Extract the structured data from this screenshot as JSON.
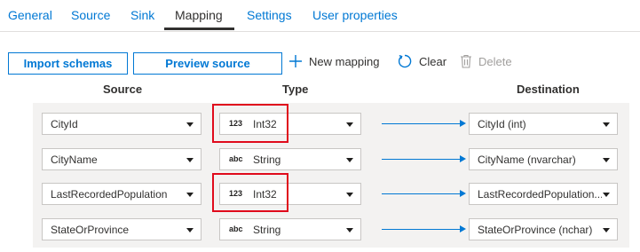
{
  "tabs": [
    {
      "label": "General"
    },
    {
      "label": "Source"
    },
    {
      "label": "Sink"
    },
    {
      "label": "Mapping"
    },
    {
      "label": "Settings"
    },
    {
      "label": "User properties"
    }
  ],
  "active_tab": "Mapping",
  "toolbar": {
    "import_schemas": "Import schemas",
    "preview_source": "Preview source",
    "new_mapping": "New mapping",
    "clear": "Clear",
    "delete": "Delete"
  },
  "columns": {
    "source": "Source",
    "type": "Type",
    "destination": "Destination"
  },
  "rows": [
    {
      "source": "CityId",
      "type_badge": "123",
      "type": "Int32",
      "destination": "CityId (int)",
      "highlighted": true
    },
    {
      "source": "CityName",
      "type_badge": "abc",
      "type": "String",
      "destination": "CityName (nvarchar)",
      "highlighted": false
    },
    {
      "source": "LastRecordedPopulation",
      "type_badge": "123",
      "type": "Int32",
      "destination": "LastRecordedPopulation...",
      "highlighted": true
    },
    {
      "source": "StateOrProvince",
      "type_badge": "abc",
      "type": "String",
      "destination": "StateOrProvince (nchar)",
      "highlighted": false
    }
  ],
  "colors": {
    "accent": "#0078d4",
    "highlight": "#e00b1c",
    "grid_bg": "#f3f2f1"
  },
  "icons": {
    "new_mapping": "plus-icon",
    "clear": "refresh-icon",
    "delete": "trash-icon"
  }
}
